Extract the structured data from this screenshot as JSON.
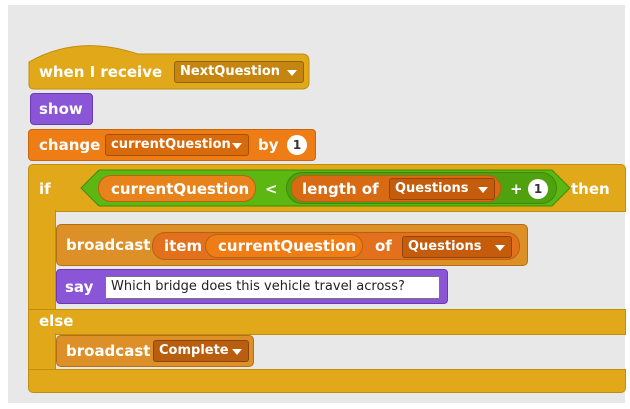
{
  "script": {
    "hat": {
      "label": "when I receive",
      "message": "NextQuestion"
    },
    "show": {
      "label": "show"
    },
    "change": {
      "label": "change",
      "variable": "currentQuestion",
      "by_label": "by",
      "value": "1"
    },
    "if_else": {
      "if_label": "if",
      "then_label": "then",
      "else_label": "else",
      "condition": {
        "left_reporter": "currentQuestion",
        "operator": "<",
        "length_label": "length of",
        "list": "Questions",
        "plus_operator": "+",
        "plus_value": "1"
      },
      "then_blocks": {
        "broadcast_label": "broadcast",
        "item_label": "item",
        "item_index": "currentQuestion",
        "of_label": "of",
        "item_list": "Questions",
        "say_label": "say",
        "say_text": "Which bridge does this vehicle travel across?"
      },
      "else_blocks": {
        "broadcast_label": "broadcast",
        "message": "Complete"
      }
    }
  },
  "colors": {
    "events": "#e1a91a",
    "looks": "#8a55d7",
    "data": "#ee7d16",
    "operators": "#5cb712",
    "sensing": "#e8831b",
    "canvas": "#e8e8e8"
  }
}
